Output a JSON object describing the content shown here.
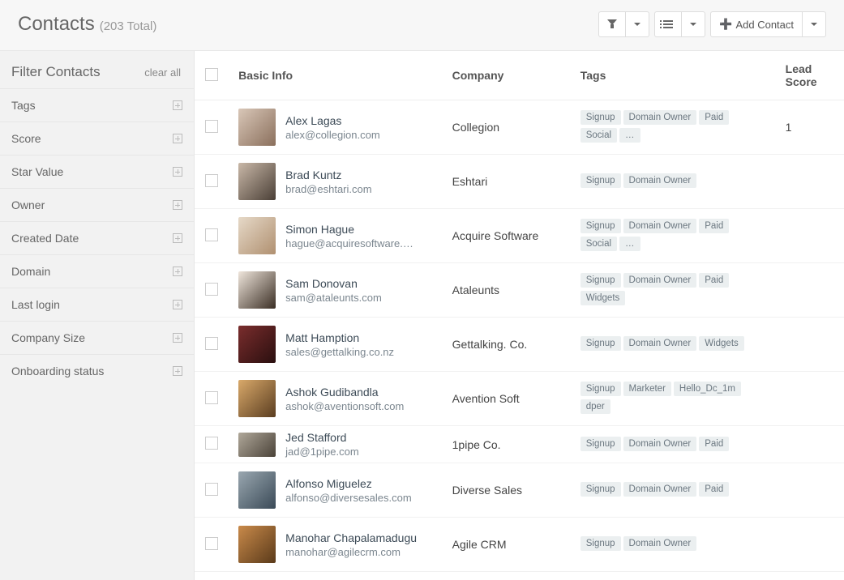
{
  "header": {
    "title": "Contacts",
    "subtitle": "(203 Total)",
    "add_label": "Add Contact"
  },
  "sidebar": {
    "title": "Filter Contacts",
    "clear": "clear all",
    "filters": [
      {
        "label": "Tags"
      },
      {
        "label": "Score"
      },
      {
        "label": "Star Value"
      },
      {
        "label": "Owner"
      },
      {
        "label": "Created Date"
      },
      {
        "label": "Domain"
      },
      {
        "label": "Last login"
      },
      {
        "label": "Company Size"
      },
      {
        "label": "Onboarding status"
      }
    ]
  },
  "table": {
    "columns": {
      "basic": "Basic Info",
      "company": "Company",
      "tags": "Tags",
      "lead": "Lead Score"
    },
    "rows": [
      {
        "name": "Alex Lagas",
        "email": "alex@collegion.com",
        "company": "Collegion",
        "tags": [
          "Signup",
          "Domain Owner",
          "Paid",
          "Social",
          "…"
        ],
        "lead": "1"
      },
      {
        "name": "Brad Kuntz",
        "email": "brad@eshtari.com",
        "company": "Eshtari",
        "tags": [
          "Signup",
          "Domain Owner"
        ],
        "lead": ""
      },
      {
        "name": "Simon Hague",
        "email": "hague@acquiresoftware.…",
        "company": "Acquire Software",
        "tags": [
          "Signup",
          "Domain Owner",
          "Paid",
          "Social",
          "…"
        ],
        "lead": ""
      },
      {
        "name": "Sam Donovan",
        "email": "sam@ataleunts.com",
        "company": "Ataleunts",
        "tags": [
          "Signup",
          "Domain Owner",
          "Paid",
          "Widgets"
        ],
        "lead": ""
      },
      {
        "name": "Matt Hamption",
        "email": "sales@gettalking.co.nz",
        "company": "Gettalking. Co.",
        "tags": [
          "Signup",
          "Domain Owner",
          "Widgets"
        ],
        "lead": ""
      },
      {
        "name": "Ashok Gudibandla",
        "email": "ashok@aventionsoft.com",
        "company": "Avention Soft",
        "tags": [
          "Signup",
          "Marketer",
          "Hello_Dc_1m",
          "dper"
        ],
        "lead": ""
      },
      {
        "name": "Jed Stafford",
        "email": "jad@1pipe.com",
        "company": "1pipe Co.",
        "tags": [
          "Signup",
          "Domain Owner",
          "Paid"
        ],
        "lead": ""
      },
      {
        "name": "Alfonso Miguelez",
        "email": "alfonso@diversesales.com",
        "company": "Diverse Sales",
        "tags": [
          "Signup",
          "Domain Owner",
          "Paid"
        ],
        "lead": ""
      },
      {
        "name": "Manohar Chapalamadugu",
        "email": "manohar@agilecrm.com",
        "company": "Agile CRM",
        "tags": [
          "Signup",
          "Domain Owner"
        ],
        "lead": ""
      }
    ]
  }
}
